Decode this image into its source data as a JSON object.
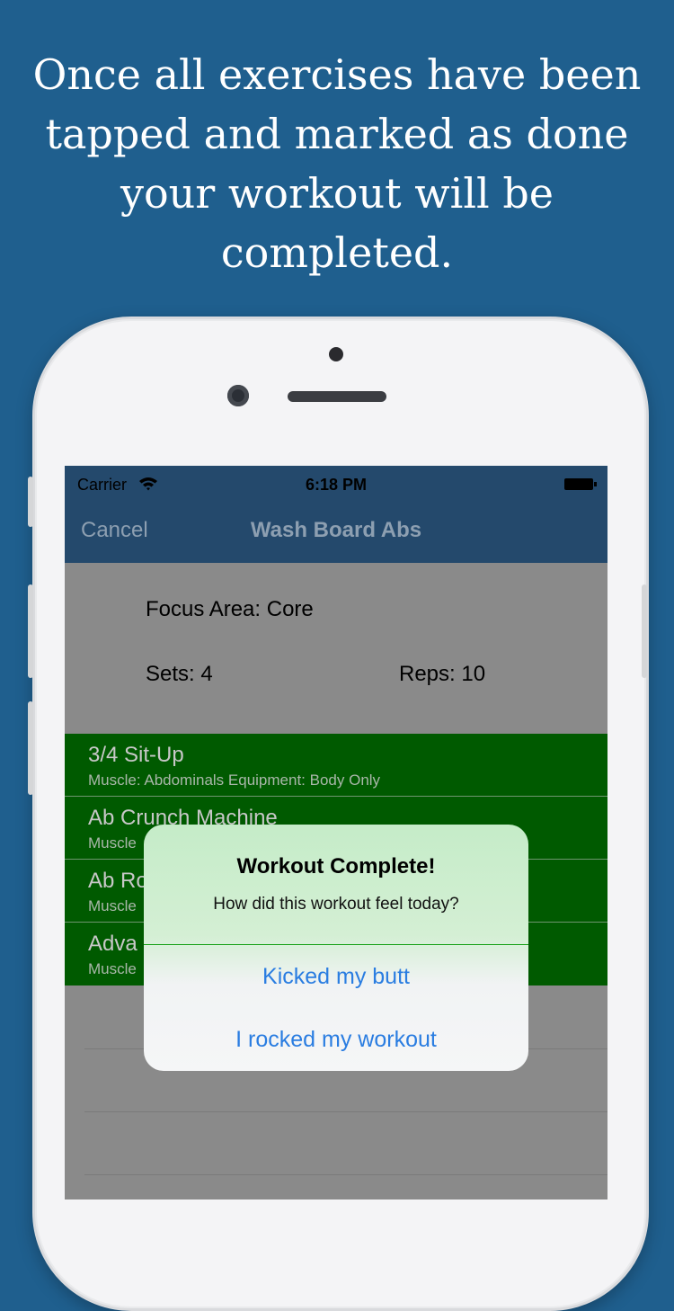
{
  "headline": {
    "line1": "Once all exercises have been",
    "line2": "tapped and marked as done",
    "line3": "your workout will be",
    "line4": "completed."
  },
  "status_bar": {
    "carrier": "Carrier",
    "time": "6:18 PM"
  },
  "nav": {
    "cancel_label": "Cancel",
    "title": "Wash Board Abs"
  },
  "workout_info": {
    "focus": "Focus Area: Core",
    "sets": "Sets: 4",
    "reps": "Reps: 10"
  },
  "exercises": [
    {
      "name": "3/4 Sit-Up",
      "detail": "Muscle:  Abdominals   Equipment:  Body Only"
    },
    {
      "name": "Ab Crunch Machine",
      "detail": "Muscle"
    },
    {
      "name": "Ab Ro",
      "detail": "Muscle"
    },
    {
      "name": "Adva",
      "detail": "Muscle"
    }
  ],
  "alert": {
    "title": "Workout Complete!",
    "message": "How did this workout feel today?",
    "buttons": [
      "Kicked my butt",
      "I rocked my workout"
    ]
  },
  "colors": {
    "background": "#1f5f8e",
    "nav_bar": "#24496c",
    "completed_row": "#005a00",
    "alert_button_text": "#2a7de1"
  }
}
